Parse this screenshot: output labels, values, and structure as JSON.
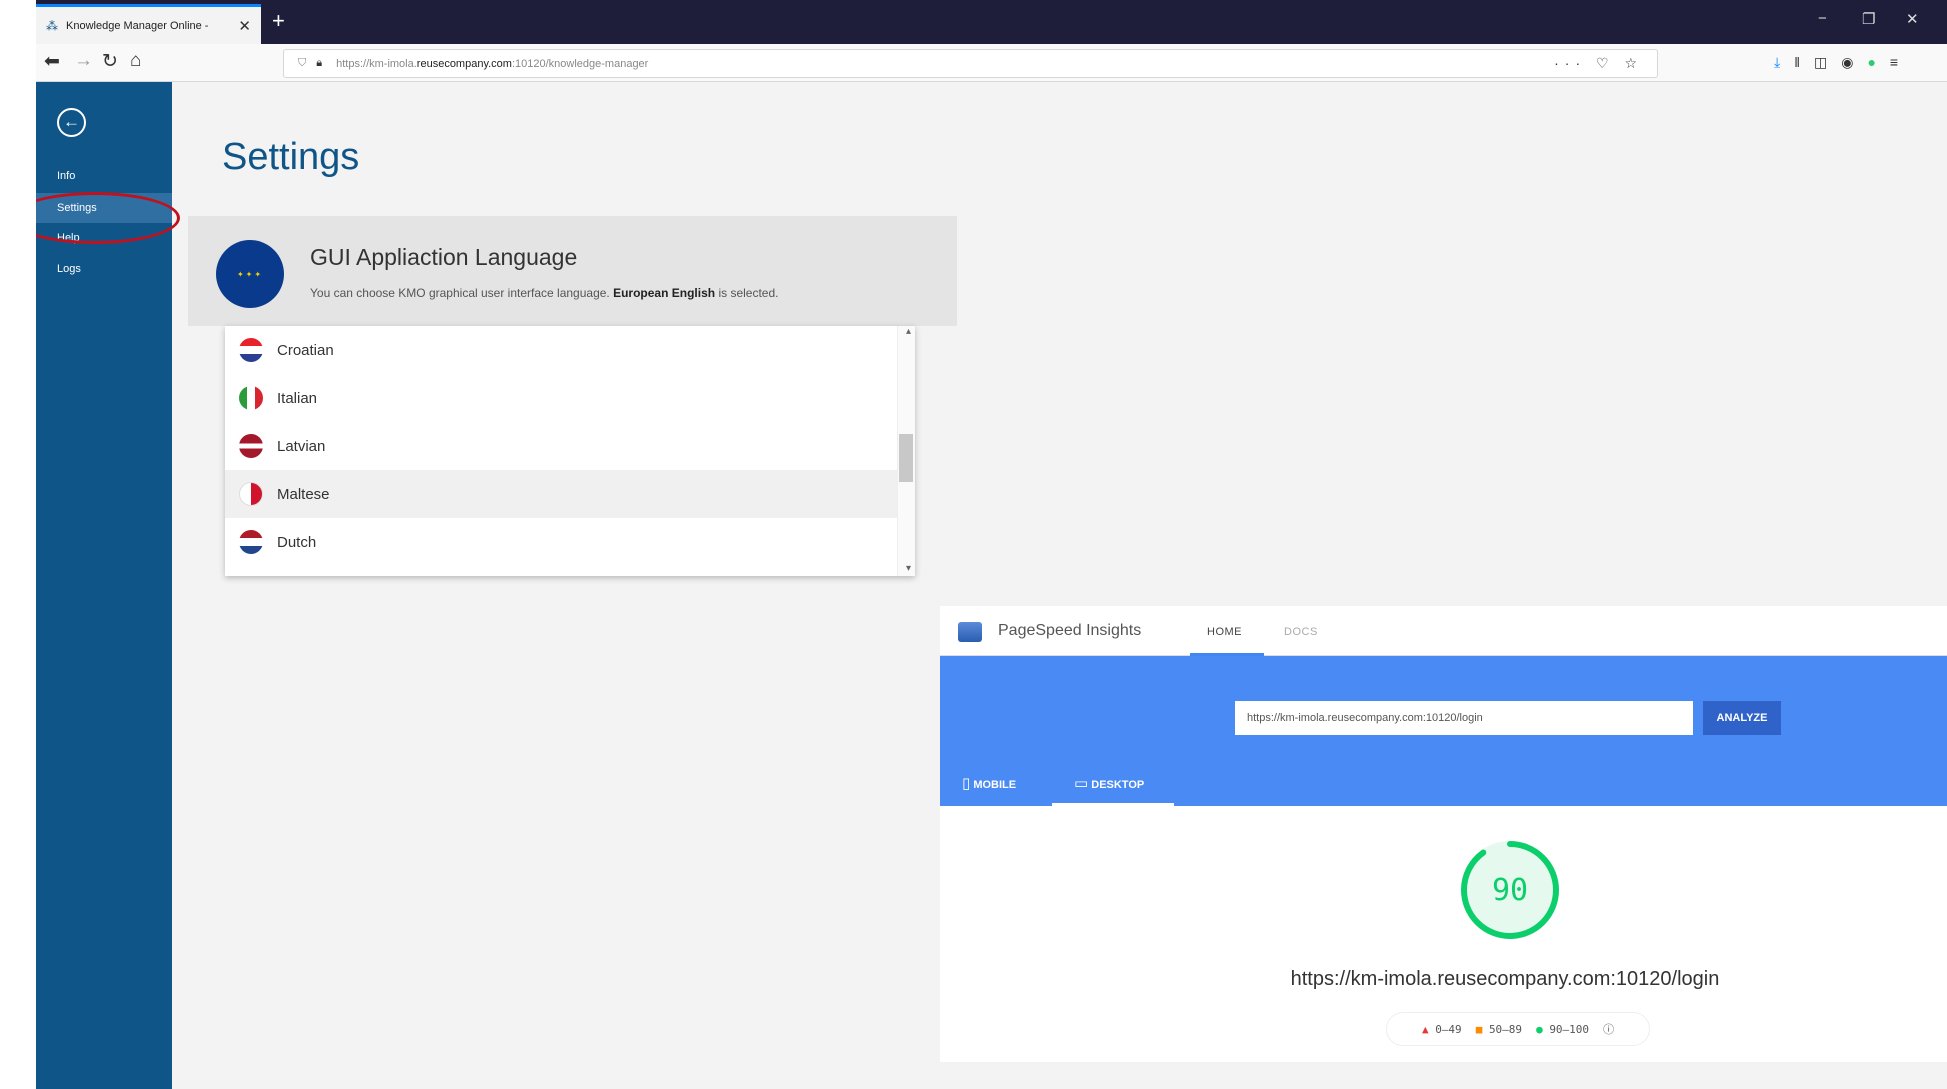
{
  "browser": {
    "tab_title": "Knowledge Manager Online - ",
    "tab_close": "✕",
    "new_tab": "+",
    "url_prefix": "https://km-imola.",
    "url_domain": "reusecompany.com",
    "url_suffix": ":10120/knowledge-manager",
    "url_actions": "··· ♡ ☆",
    "minimize": "−",
    "restore": "❐",
    "close": "✕"
  },
  "sidebar": {
    "items": [
      {
        "label": "Info"
      },
      {
        "label": "Settings"
      },
      {
        "label": "Help"
      },
      {
        "label": "Logs"
      }
    ]
  },
  "main": {
    "title": "Settings",
    "language": {
      "heading": "GUI Appliaction Language",
      "description_prefix": "You can choose KMO graphical user interface language. ",
      "selected_language": "European English",
      "description_suffix": " is selected.",
      "options": [
        {
          "label": "Croatian",
          "flag": "flag-hr"
        },
        {
          "label": "Italian",
          "flag": "flag-it"
        },
        {
          "label": "Latvian",
          "flag": "flag-lv"
        },
        {
          "label": "Maltese",
          "flag": "flag-mt"
        },
        {
          "label": "Dutch",
          "flag": "flag-nl"
        }
      ],
      "hovered_index": 3
    }
  },
  "pagespeed": {
    "name": "PageSpeed Insights",
    "tabs": [
      "HOME",
      "DOCS"
    ],
    "active_tab": "HOME",
    "input_value": "https://km-imola.reusecompany.com:10120/login",
    "analyze_label": "ANALYZE",
    "devices": [
      "MOBILE",
      "DESKTOP"
    ],
    "active_device": "DESKTOP",
    "score": "90",
    "score_value": 90,
    "tested_url": "https://km-imola.reusecompany.com:10120/login",
    "legend": {
      "low": "0–49",
      "mid": "50–89",
      "high": "90–100"
    },
    "colors": {
      "good": "#0cce6b",
      "accent": "#4a8af4"
    }
  }
}
